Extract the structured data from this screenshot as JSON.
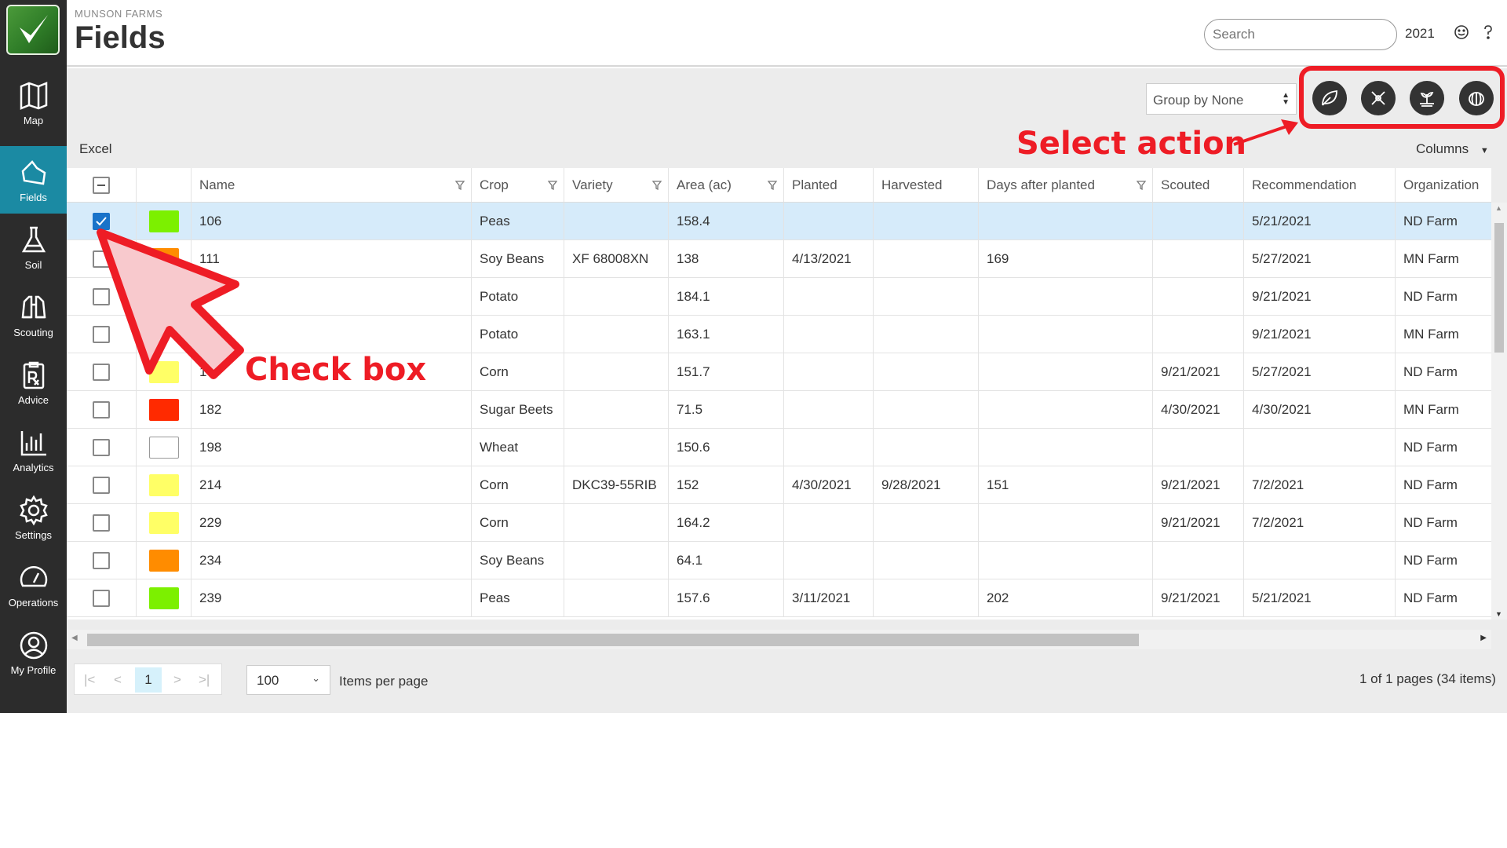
{
  "sidebar": {
    "items": [
      {
        "label": "Map",
        "icon": "map-icon"
      },
      {
        "label": "Fields",
        "icon": "field-icon",
        "active": true
      },
      {
        "label": "Soil",
        "icon": "flask-icon"
      },
      {
        "label": "Scouting",
        "icon": "binoculars-icon"
      },
      {
        "label": "Advice",
        "icon": "prescription-icon"
      },
      {
        "label": "Analytics",
        "icon": "bar-chart-icon"
      },
      {
        "label": "Settings",
        "icon": "gear-icon"
      },
      {
        "label": "Operations",
        "icon": "gauge-icon"
      },
      {
        "label": "My Profile",
        "icon": "user-circle-icon"
      }
    ]
  },
  "header": {
    "org": "MUNSON FARMS",
    "title": "Fields",
    "search_placeholder": "Search",
    "year": "2021"
  },
  "toolbar": {
    "group_by": "Group by None",
    "excel": "Excel",
    "columns": "Columns"
  },
  "table": {
    "headers": [
      "Name",
      "Crop",
      "Variety",
      "Area (ac)",
      "Planted",
      "Harvested",
      "Days after planted",
      "Scouted",
      "Recommendation",
      "Organization"
    ],
    "rows": [
      {
        "color": "#7cf000",
        "name": "106",
        "crop": "Peas",
        "variety": "",
        "area": "158.4",
        "planted": "",
        "harvested": "",
        "days": "",
        "scouted": "",
        "rec": "5/21/2021",
        "org": "ND Farm",
        "checked": true
      },
      {
        "color": "#ff8c00",
        "name": "111",
        "crop": "Soy Beans",
        "variety": "XF 68008XN",
        "area": "138",
        "planted": "4/13/2021",
        "harvested": "",
        "days": "169",
        "scouted": "",
        "rec": "5/27/2021",
        "org": "MN Farm"
      },
      {
        "color": "",
        "name": "",
        "crop": "Potato",
        "variety": "",
        "area": "184.1",
        "planted": "",
        "harvested": "",
        "days": "",
        "scouted": "",
        "rec": "9/21/2021",
        "org": "ND Farm"
      },
      {
        "color": "",
        "name": "",
        "crop": "Potato",
        "variety": "",
        "area": "163.1",
        "planted": "",
        "harvested": "",
        "days": "",
        "scouted": "",
        "rec": "9/21/2021",
        "org": "MN Farm"
      },
      {
        "color": "#ffff66",
        "name": "17",
        "crop": "Corn",
        "variety": "",
        "area": "151.7",
        "planted": "",
        "harvested": "",
        "days": "",
        "scouted": "9/21/2021",
        "rec": "5/27/2021",
        "org": "ND Farm"
      },
      {
        "color": "#ff2a00",
        "name": "182",
        "crop": "Sugar Beets",
        "variety": "",
        "area": "71.5",
        "planted": "",
        "harvested": "",
        "days": "",
        "scouted": "4/30/2021",
        "rec": "4/30/2021",
        "org": "MN Farm"
      },
      {
        "color": "#ffffff",
        "name": "198",
        "crop": "Wheat",
        "variety": "",
        "area": "150.6",
        "planted": "",
        "harvested": "",
        "days": "",
        "scouted": "",
        "rec": "",
        "org": "ND Farm"
      },
      {
        "color": "#ffff66",
        "name": "214",
        "crop": "Corn",
        "variety": "DKC39-55RIB",
        "area": "152",
        "planted": "4/30/2021",
        "harvested": "9/28/2021",
        "days": "151",
        "scouted": "9/21/2021",
        "rec": "7/2/2021",
        "org": "ND Farm"
      },
      {
        "color": "#ffff66",
        "name": "229",
        "crop": "Corn",
        "variety": "",
        "area": "164.2",
        "planted": "",
        "harvested": "",
        "days": "",
        "scouted": "9/21/2021",
        "rec": "7/2/2021",
        "org": "ND Farm"
      },
      {
        "color": "#ff8c00",
        "name": "234",
        "crop": "Soy Beans",
        "variety": "",
        "area": "64.1",
        "planted": "",
        "harvested": "",
        "days": "",
        "scouted": "",
        "rec": "",
        "org": "ND Farm"
      },
      {
        "color": "#7cf000",
        "name": "239",
        "crop": "Peas",
        "variety": "",
        "area": "157.6",
        "planted": "3/11/2021",
        "harvested": "",
        "days": "202",
        "scouted": "9/21/2021",
        "rec": "5/21/2021",
        "org": "ND Farm"
      }
    ]
  },
  "pager": {
    "current_page": "1",
    "per_page": "100",
    "per_page_label": "Items per page",
    "info": "1 of 1 pages (34 items)"
  },
  "annotations": {
    "select_action": "Select action",
    "check_box": "Check box"
  },
  "colors": {
    "sidebar_bg": "#2c2c2c",
    "active_nav": "#1b8aa3",
    "annotation_red": "#ee1c25",
    "selected_row": "#d6ebfa"
  }
}
